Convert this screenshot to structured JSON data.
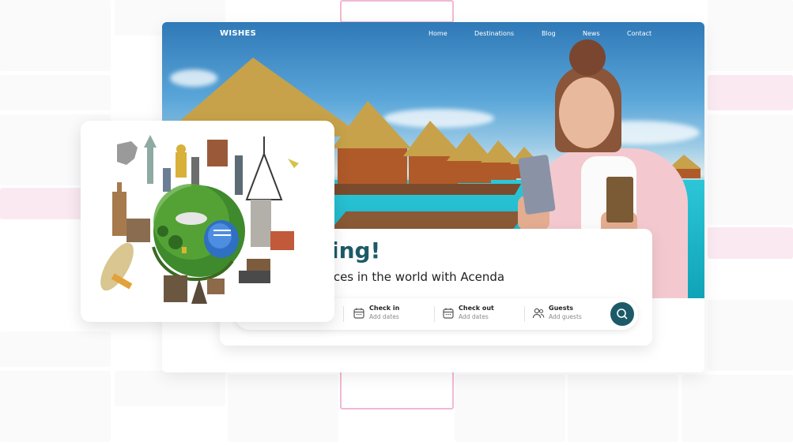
{
  "brand": {
    "logo": "WISHES"
  },
  "nav": {
    "items": [
      {
        "label": "Home"
      },
      {
        "label": "Destinations"
      },
      {
        "label": "Blog"
      },
      {
        "label": "News"
      },
      {
        "label": "Contact"
      }
    ]
  },
  "hero": {
    "greeting": "orning!",
    "subtitle": "l places in the world with Acenda"
  },
  "search": {
    "fields": [
      {
        "label": "Check in",
        "placeholder": "Add dates",
        "icon": "calendar-icon"
      },
      {
        "label": "Check out",
        "placeholder": "Add dates",
        "icon": "calendar-icon"
      },
      {
        "label": "Guests",
        "placeholder": "Add guests",
        "icon": "guests-icon"
      }
    ],
    "button_icon": "search-icon"
  },
  "colors": {
    "accent": "#1d5a67",
    "highlight": "#f2b8d4"
  }
}
